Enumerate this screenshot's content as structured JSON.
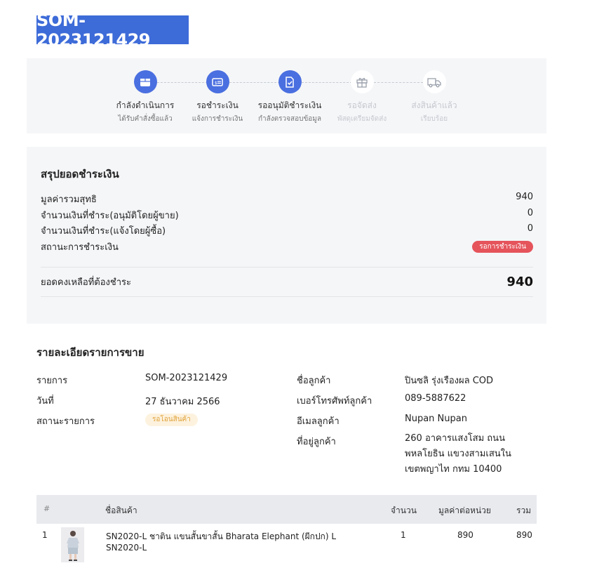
{
  "order_id": "SOM-2023121429",
  "steps": [
    {
      "label": "กำลังดำเนินการ",
      "sub": "ได้รับคำสั่งซื้อแล้ว",
      "icon": "box-icon",
      "active": true
    },
    {
      "label": "รอชำระเงิน",
      "sub": "แจ้งการชำระเงิน",
      "icon": "payment-card-icon",
      "active": true
    },
    {
      "label": "รออนุมัติชำระเงิน",
      "sub": "กำลังตรวจสอบข้อมูล",
      "icon": "document-check-icon",
      "active": true
    },
    {
      "label": "รอจัดส่ง",
      "sub": "พัสดุเตรียมจัดส่ง",
      "icon": "gift-icon",
      "active": false
    },
    {
      "label": "ส่งสินค้าแล้ว",
      "sub": "เรียบร้อย",
      "icon": "truck-icon",
      "active": false
    }
  ],
  "summary": {
    "title": "สรุปยอดชำระเงิน",
    "net_total_label": "มูลค่ารวมสุทธิ",
    "net_total": "940",
    "paid_seller_label": "จำนวนเงินที่ชำระ(อนุมัติโดยผู้ขาย)",
    "paid_seller": "0",
    "paid_buyer_label": "จำนวนเงินที่ชำระ(แจ้งโดยผู้ซื้อ)",
    "paid_buyer": "0",
    "payment_status_label": "สถานะการชำระเงิน",
    "payment_status": "รอการชำระเงิน",
    "balance_label": "ยอดคงเหลือที่ต้องชำระ",
    "balance": "940"
  },
  "details": {
    "title": "รายละเอียดรายการขาย",
    "order_label": "รายการ",
    "order_value": "SOM-2023121429",
    "date_label": "วันที่",
    "date_value": "27 ธันวาคม 2566",
    "status_label": "สถานะรายการ",
    "status_value": "รอโอนสินค้า",
    "customer_label": "ชื่อลูกค้า",
    "customer_value": "ปินซลิ รุ่งเรืองผล COD",
    "phone_label": "เบอร์โทรศัพท์ลูกค้า",
    "phone_value": "089-5887622",
    "email_label": "อีเมลลูกค้า",
    "email_value": "Nupan Nupan",
    "address_label": "ที่อยู่ลูกค้า",
    "address_lines": [
      "260 อาคารแสงโสม ถนน",
      "พหลโยธิน แขวงสามเสนใน",
      "เขตพญาไท กทม 10400"
    ]
  },
  "table": {
    "headers": {
      "num": "#",
      "name": "ชื่อสินค้า",
      "qty": "จำนวน",
      "unit_price": "มูลค่าต่อหน่วย",
      "total": "รวม"
    },
    "rows": [
      {
        "num": "1",
        "name_line1": "SN2020-L ชาติน แขนสั้นขาสั้น Bharata Elephant (ผีกปก) L",
        "name_line2": "SN2020-L",
        "qty": "1",
        "unit_price": "890",
        "total": "890"
      }
    ]
  },
  "colors": {
    "accent": "#4a6fe0",
    "title_bg": "#3d6bd8",
    "badge_red": "#e5545b",
    "badge_yellow_bg": "#fdf2de",
    "badge_yellow_text": "#e0a23a"
  }
}
